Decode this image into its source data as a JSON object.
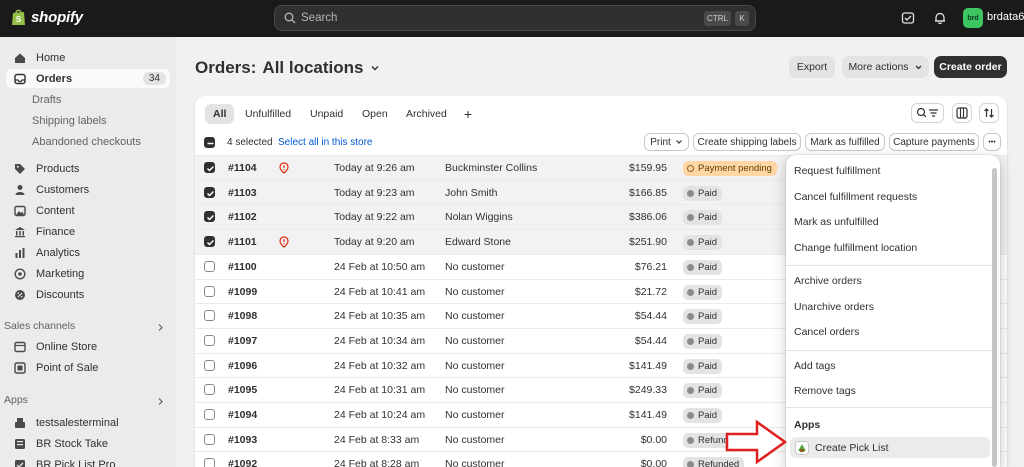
{
  "brand": {
    "name": "shopify"
  },
  "search": {
    "placeholder": "Search",
    "shortcut_ctrl": "CTRL",
    "shortcut_k": "K"
  },
  "user": {
    "initials": "brd",
    "name": "brdata6"
  },
  "sidebar": {
    "items": [
      {
        "label": "Home",
        "icon": "home-icon"
      },
      {
        "label": "Orders",
        "icon": "inbox-icon",
        "badge": "34"
      },
      {
        "label": "Products",
        "icon": "tag-icon"
      },
      {
        "label": "Customers",
        "icon": "person-icon"
      },
      {
        "label": "Content",
        "icon": "image-icon"
      },
      {
        "label": "Finance",
        "icon": "bank-icon"
      },
      {
        "label": "Analytics",
        "icon": "chart-icon"
      },
      {
        "label": "Marketing",
        "icon": "target-icon"
      },
      {
        "label": "Discounts",
        "icon": "discount-icon"
      }
    ],
    "order_subitems": [
      "Drafts",
      "Shipping labels",
      "Abandoned checkouts"
    ],
    "sales_channels": {
      "heading": "Sales channels",
      "items": [
        "Online Store",
        "Point of Sale"
      ]
    },
    "apps": {
      "heading": "Apps",
      "items": [
        "testsalesterminal",
        "BR Stock Take",
        "BR Pick List Pro"
      ]
    }
  },
  "header": {
    "title": "Orders:",
    "location": "All locations",
    "export_label": "Export",
    "more_actions_label": "More actions",
    "create_order_label": "Create order"
  },
  "tabs": [
    "All",
    "Unfulfilled",
    "Unpaid",
    "Open",
    "Archived"
  ],
  "add_tab": "+",
  "bulk": {
    "selected_text": "4 selected",
    "select_all_text": "Select all in this store",
    "print_label": "Print",
    "create_labels_label": "Create shipping labels",
    "mark_fulfilled_label": "Mark as fulfilled",
    "capture_payments_label": "Capture payments",
    "more_label": "•••"
  },
  "orders": [
    {
      "id": "#1104",
      "flag": true,
      "date": "Today at 9:26 am",
      "customer": "Buckminster Collins",
      "total": "$159.95",
      "status": "Payment pending",
      "selected": true
    },
    {
      "id": "#1103",
      "flag": false,
      "date": "Today at 9:23 am",
      "customer": "John Smith",
      "total": "$166.85",
      "status": "Paid",
      "selected": true
    },
    {
      "id": "#1102",
      "flag": false,
      "date": "Today at 9:22 am",
      "customer": "Nolan Wiggins",
      "total": "$386.06",
      "status": "Paid",
      "selected": true
    },
    {
      "id": "#1101",
      "flag": true,
      "date": "Today at 9:20 am",
      "customer": "Edward Stone",
      "total": "$251.90",
      "status": "Paid",
      "selected": true
    },
    {
      "id": "#1100",
      "flag": false,
      "date": "24 Feb at 10:50 am",
      "customer": "No customer",
      "total": "$76.21",
      "status": "Paid",
      "selected": false
    },
    {
      "id": "#1099",
      "flag": false,
      "date": "24 Feb at 10:41 am",
      "customer": "No customer",
      "total": "$21.72",
      "status": "Paid",
      "selected": false
    },
    {
      "id": "#1098",
      "flag": false,
      "date": "24 Feb at 10:35 am",
      "customer": "No customer",
      "total": "$54.44",
      "status": "Paid",
      "selected": false
    },
    {
      "id": "#1097",
      "flag": false,
      "date": "24 Feb at 10:34 am",
      "customer": "No customer",
      "total": "$54.44",
      "status": "Paid",
      "selected": false
    },
    {
      "id": "#1096",
      "flag": false,
      "date": "24 Feb at 10:32 am",
      "customer": "No customer",
      "total": "$141.49",
      "status": "Paid",
      "selected": false
    },
    {
      "id": "#1095",
      "flag": false,
      "date": "24 Feb at 10:31 am",
      "customer": "No customer",
      "total": "$249.33",
      "status": "Paid",
      "selected": false
    },
    {
      "id": "#1094",
      "flag": false,
      "date": "24 Feb at 10:24 am",
      "customer": "No customer",
      "total": "$141.49",
      "status": "Paid",
      "selected": false
    },
    {
      "id": "#1093",
      "flag": false,
      "date": "24 Feb at 8:33 am",
      "customer": "No customer",
      "total": "$0.00",
      "status": "Refunded",
      "selected": false
    },
    {
      "id": "#1092",
      "flag": false,
      "date": "24 Feb at 8:28 am",
      "customer": "No customer",
      "total": "$0.00",
      "status": "Refunded",
      "selected": false
    }
  ],
  "menu": {
    "group1": [
      "Request fulfillment",
      "Cancel fulfillment requests",
      "Mark as unfulfilled",
      "Change fulfillment location"
    ],
    "group2": [
      "Archive orders",
      "Unarchive orders",
      "Cancel orders"
    ],
    "group3": [
      "Add tags",
      "Remove tags"
    ],
    "apps_heading": "Apps",
    "apps_item": "Create Pick List"
  },
  "colors": {
    "topbar": "#1a1a1a",
    "accent_link": "#005bd3",
    "avatar": "#3cc560",
    "pending_badge": "#ffd6a4",
    "annotation_arrow": "#e02020"
  }
}
